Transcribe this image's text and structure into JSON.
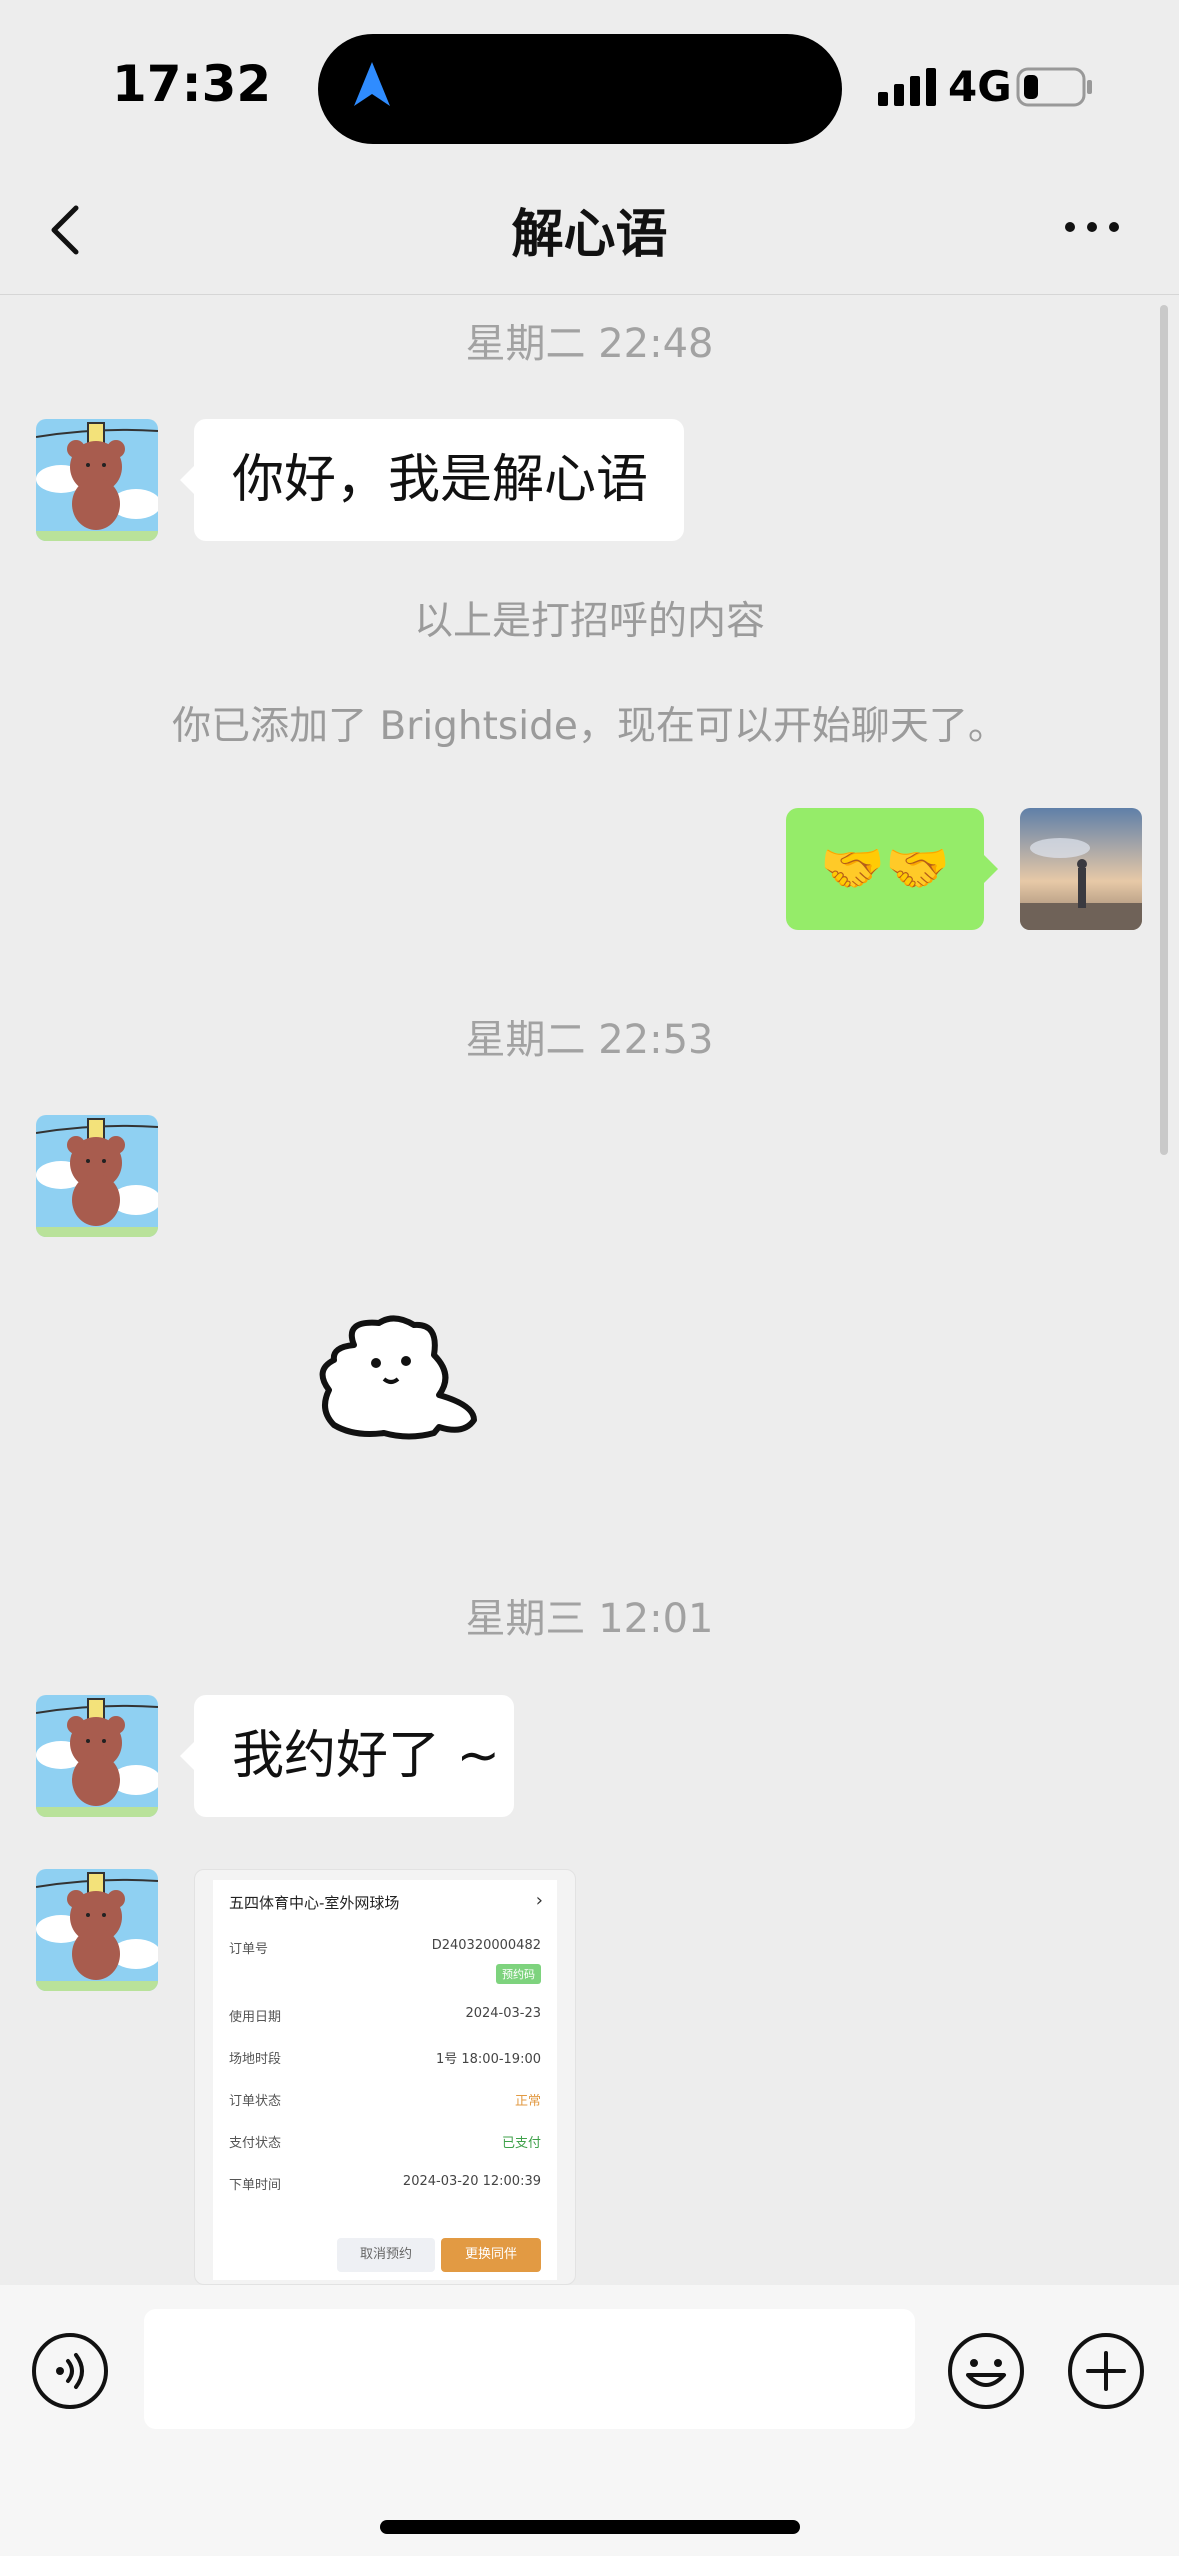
{
  "status_bar": {
    "time": "17:32",
    "network": "4G",
    "battery_level": 0.2
  },
  "header": {
    "title": "解心语"
  },
  "messages": {
    "ts1": "星期二 22:48",
    "greeting": "你好，我是解心语",
    "sys1": "以上是打招呼的内容",
    "sys2": "你已添加了 Brightside，现在可以开始聊天了。",
    "sent_emoji": "🤝🤝",
    "ts2": "星期二 22:53",
    "ts3": "星期三 12:01",
    "reply": "我约好了 ~"
  },
  "order_card": {
    "venue": "五四体育中心-室外网球场",
    "rows": [
      {
        "label": "订单号",
        "value": "D240320000482"
      },
      {
        "label": "使用日期",
        "value": "2024-03-23"
      },
      {
        "label": "场地时段",
        "value": "1号 18:00-19:00"
      },
      {
        "label": "订单状态",
        "value": "正常"
      },
      {
        "label": "支付状态",
        "value": "已支付"
      },
      {
        "label": "下单时间",
        "value": "2024-03-20 12:00:39"
      }
    ],
    "tag": "预约码",
    "cancel_label": "取消预约",
    "change_label": "更换同伴"
  },
  "colors": {
    "sent_bubble": "#95ec69",
    "status_ok": "#e29a43",
    "paid": "#3fa14a"
  }
}
